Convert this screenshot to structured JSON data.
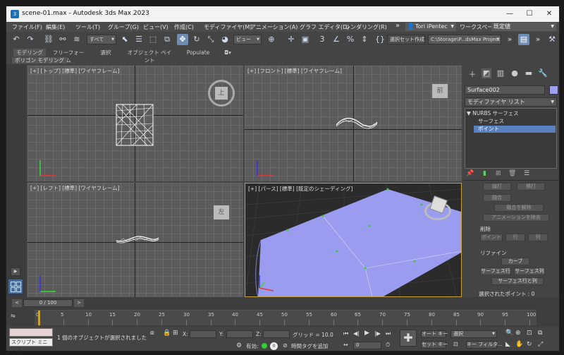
{
  "window": {
    "title": "scene-01.max - Autodesk 3ds Max 2023"
  },
  "menu": [
    "ファイル(F)",
    "編集(E)",
    "ツール(T)",
    "グループ(G)",
    "ビュー(V)",
    "作成(C)",
    "モディファイヤ(M)",
    "アニメーション(A)",
    "グラフ エディタ(D)",
    "レンダリング(R)"
  ],
  "menu_more": "»",
  "user": "Tori iPentec",
  "workspace_label": "ワークスペース:",
  "workspace_value": "既定値",
  "toolbar": {
    "selection_filter": "すべて",
    "view_dropdown": "ビュー",
    "named_selection": "選択セット作成",
    "project_path": "C:\\Storage\\P...dsMax Project"
  },
  "ribbon": {
    "tabs": [
      "モデリング",
      "フリーフォーム",
      "選択",
      "オブジェクト ペイント",
      "Populate"
    ],
    "sub": "ポリゴン モデリング"
  },
  "viewports": {
    "top": {
      "label": "[+] [トップ] [標準] [ワイヤフレーム]",
      "cube": "上"
    },
    "front": {
      "label": "[+] [フロント] [標準] [ワイヤフレーム]",
      "cube": "前"
    },
    "left": {
      "label": "[+] [レフト] [標準] [ワイヤフレーム]",
      "cube": "左"
    },
    "persp": {
      "label": "[+] [パース] [標準] [既定のシェーディング]"
    }
  },
  "command_panel": {
    "object_name": "Surface002",
    "object_color": "#9fa0ef",
    "modifier_list": "モディファイヤ リスト",
    "stack": [
      "NURBS サーフェス",
      "サーフェス",
      "ポイント"
    ],
    "buttons_top": [
      "縦打",
      "横打"
    ],
    "fuse": "融合",
    "unfuse": "融合を解除",
    "remove_anim": "アニメーションを除去",
    "delete_section": "削除",
    "delete_buttons": [
      "ポイント",
      "行",
      "列"
    ],
    "refine_section": "リファイン",
    "curve_btn": "カーブ",
    "refine_buttons": [
      "サーフェス行",
      "サーフェス列"
    ],
    "refine_row_col": "サーフェス行と列",
    "selected_points": "選択されたポイント : 0"
  },
  "timeline": {
    "counter": "0 / 100",
    "ticks": [
      "0",
      "5",
      "10",
      "15",
      "20",
      "25",
      "30",
      "35",
      "40",
      "45",
      "50",
      "55",
      "60",
      "65",
      "70",
      "75",
      "80",
      "85",
      "90",
      "95",
      "100"
    ]
  },
  "status": {
    "script": "スクリプト ミニ リス",
    "message": "1 個のオブジェクトが選択されました",
    "x_label": "X:",
    "y_label": "Y:",
    "z_label": "Z:",
    "grid": "グリッド = 10.0",
    "enabled": "有効:",
    "time_tag": "時間タグを追加",
    "auto_key": "オート キー",
    "set_key": "セット キー",
    "selection": "選択",
    "key_filter": "キー フィルタ...",
    "frame": "0"
  }
}
